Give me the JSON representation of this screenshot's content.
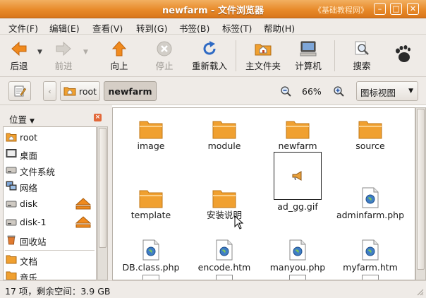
{
  "window": {
    "title": "newfarm - 文件浏览器",
    "watermark": "《基础教程网》"
  },
  "menu": [
    "文件(F)",
    "编辑(E)",
    "查看(V)",
    "转到(G)",
    "书签(B)",
    "标签(T)",
    "帮助(H)"
  ],
  "toolbar": {
    "back": "后退",
    "forward": "前进",
    "up": "向上",
    "stop": "停止",
    "reload": "重新载入",
    "home": "主文件夹",
    "computer": "计算机",
    "search": "搜索"
  },
  "location": {
    "crumbs": [
      "root",
      "newfarm"
    ],
    "zoom": "66%",
    "view_mode": "图标视图"
  },
  "sidebar": {
    "title": "位置",
    "items": [
      "root",
      "桌面",
      "文件系统",
      "网络",
      "disk",
      "disk-1",
      "回收站",
      "文档",
      "音乐"
    ]
  },
  "files": [
    {
      "name": "image",
      "type": "folder"
    },
    {
      "name": "module",
      "type": "folder"
    },
    {
      "name": "newfarm",
      "type": "folder"
    },
    {
      "name": "source",
      "type": "folder"
    },
    {
      "name": "template",
      "type": "folder"
    },
    {
      "name": "安装说明",
      "type": "folder"
    },
    {
      "name": "ad_gg.gif",
      "type": "image"
    },
    {
      "name": "adminfarm.php",
      "type": "php"
    },
    {
      "name": "DB.class.php",
      "type": "php"
    },
    {
      "name": "encode.htm",
      "type": "php"
    },
    {
      "name": "manyou.php",
      "type": "php"
    },
    {
      "name": "myfarm.htm",
      "type": "php"
    }
  ],
  "status": "17 项，剩余空间：3.9 GB",
  "colors": {
    "titlebar": "#e88a2a",
    "folder": "#f0a030",
    "panel": "#efebe7"
  }
}
